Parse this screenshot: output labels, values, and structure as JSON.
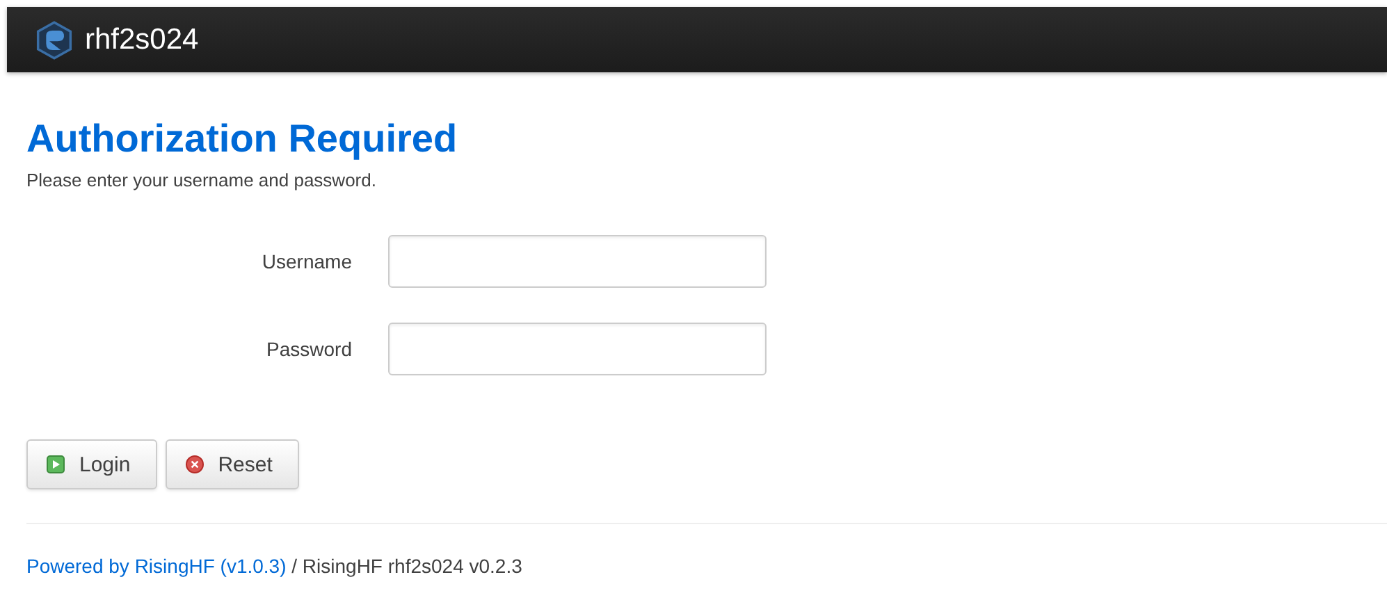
{
  "header": {
    "title": "rhf2s024"
  },
  "heading": "Authorization Required",
  "description": "Please enter your username and password.",
  "fields": [
    {
      "label": "Username"
    },
    {
      "label": "Password"
    }
  ],
  "buttons": [
    {
      "label": "Login",
      "kind": "apply"
    },
    {
      "label": "Reset",
      "kind": "reset"
    }
  ],
  "footer": {
    "link": "Powered by RisingHF (v1.0.3)",
    "text": " / RisingHF rhf2s024 v0.2.3"
  }
}
